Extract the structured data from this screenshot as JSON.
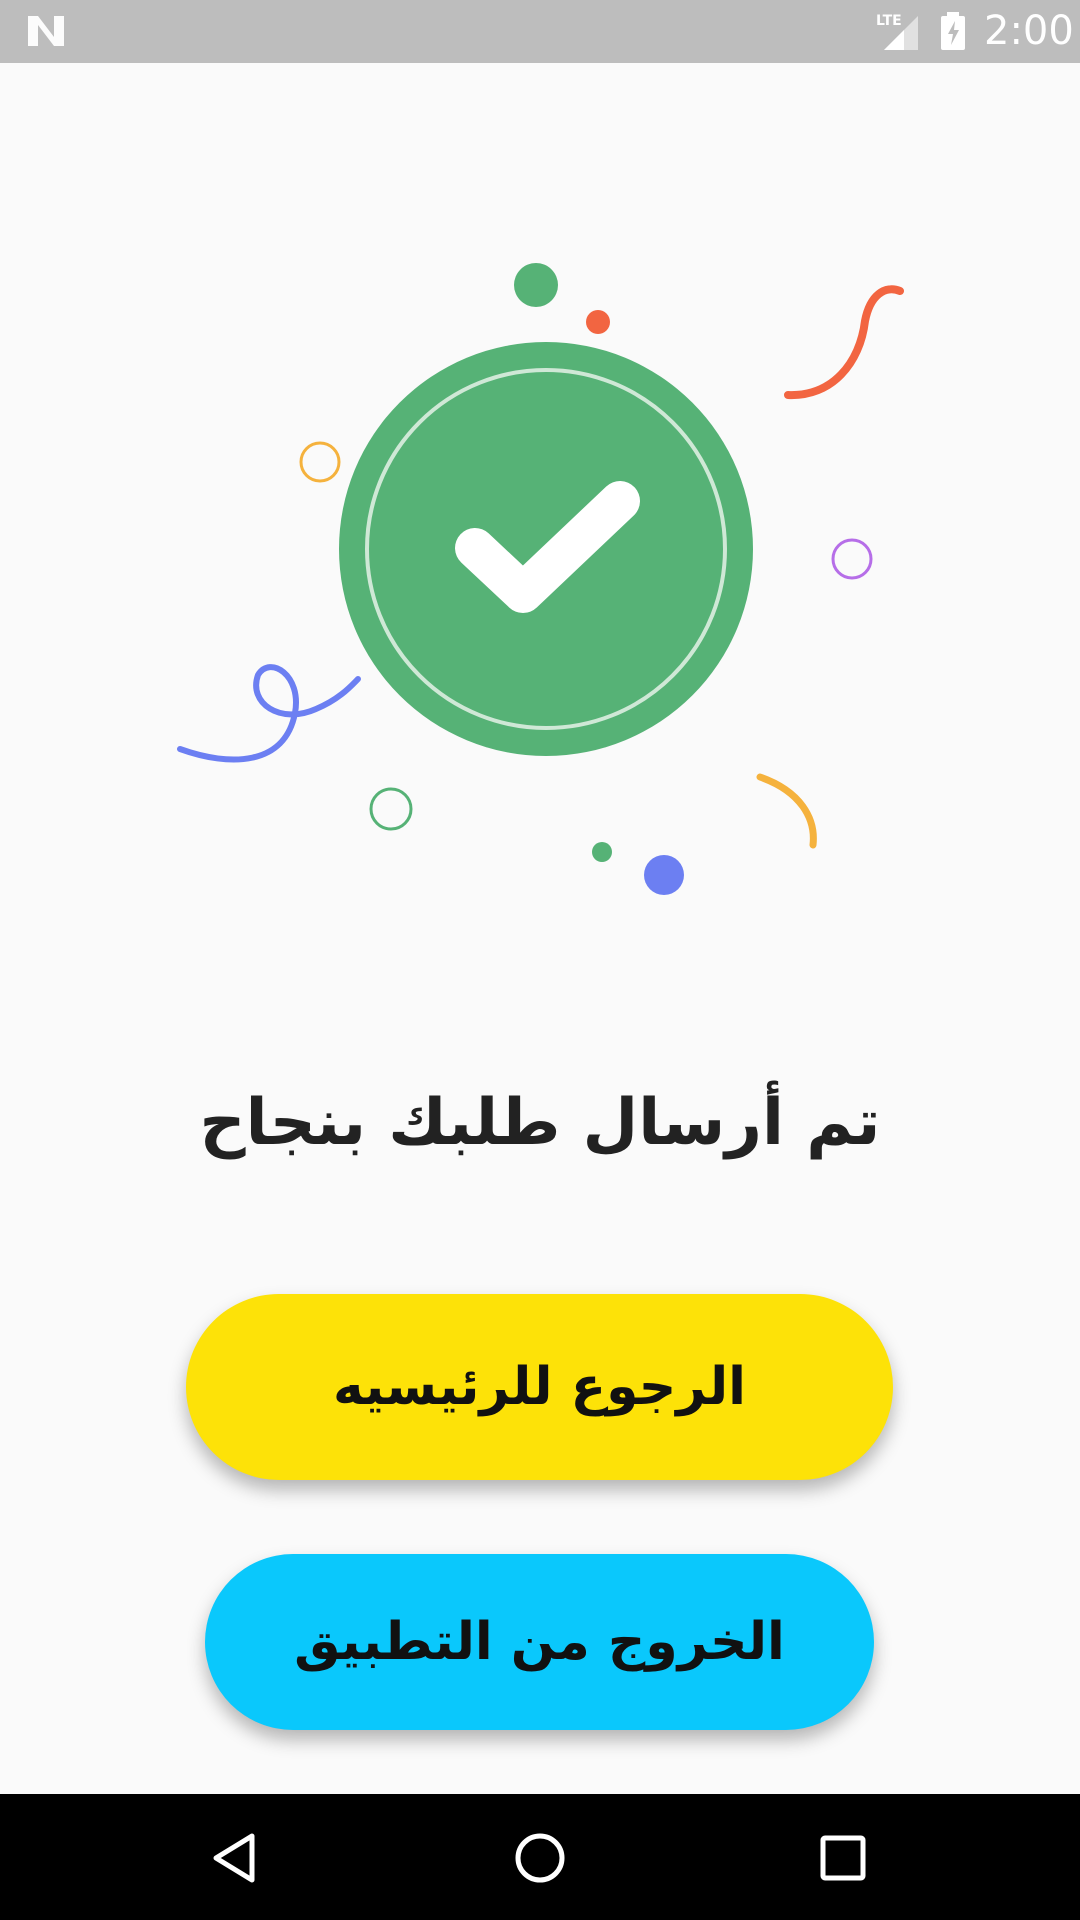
{
  "status_bar": {
    "time": "2:00",
    "network_label": "LTE",
    "icons": [
      "android-n-icon",
      "lte-signal-icon",
      "battery-charging-icon"
    ]
  },
  "success": {
    "headline": "تم أرسال طلبك بنجاح",
    "icon": "check-circle-icon",
    "accent_color": "#56b276",
    "confetti_colors": [
      "#56b276",
      "#f26541",
      "#f5b23d",
      "#b66ee8",
      "#6c7ff2"
    ]
  },
  "actions": {
    "home_label": "الرجوع للرئيسيه",
    "home_color": "#fde208",
    "exit_label": "الخروج من التطبيق",
    "exit_color": "#0ac8fc"
  },
  "nav_bar": {
    "icons": [
      "back-icon",
      "home-icon",
      "recents-icon"
    ]
  }
}
